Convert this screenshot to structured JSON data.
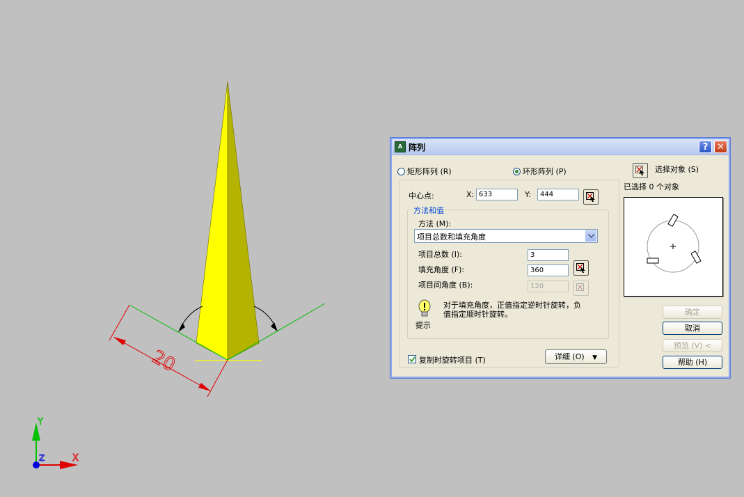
{
  "colors": {
    "background": "#c0c0c0",
    "pyramid_light": "#ffff00",
    "pyramid_dark": "#b3b300",
    "dimension": "#e00000",
    "extension_green": "#00c000",
    "axis_x": "#e00000",
    "axis_y": "#00c000",
    "axis_z": "#0000e0"
  },
  "drawing": {
    "dimension_value": "20",
    "ucs_x_label": "X",
    "ucs_y_label": "Y",
    "ucs_z_label": "Z"
  },
  "dialog": {
    "title": "阵列",
    "help_glyph": "?",
    "close_glyph": "✕",
    "app_icon_text": "A",
    "radio_rect": "矩形阵列 (R)",
    "radio_polar": "环形阵列 (P)",
    "select_objects_label": "选择对象 (S)",
    "selected_count": "已选择 0 个对象",
    "center_point_label": "中心点:",
    "center_x_label": "X:",
    "center_x_value": "633",
    "center_y_label": "Y:",
    "center_y_value": "444",
    "method_group_label": "方法和值",
    "method_label": "方法 (M):",
    "method_value": "项目总数和填充角度",
    "total_items_label": "项目总数 (I):",
    "total_items_value": "3",
    "fill_angle_label": "填充角度 (F):",
    "fill_angle_value": "360",
    "item_angle_label": "项目间角度 (B):",
    "item_angle_value": "120",
    "tip_line1": "对于填充角度，正值指定逆时针旋转，负",
    "tip_line2": "值指定顺时针旋转。",
    "tip_label": "提示",
    "rotate_items_label": "复制时旋转项目 (T)",
    "details_button": "详细 (O)",
    "details_arrow": "▼",
    "ok_button": "确定",
    "cancel_button": "取消",
    "preview_button": "预览 (V)  <",
    "help_button": "帮助 (H)"
  }
}
